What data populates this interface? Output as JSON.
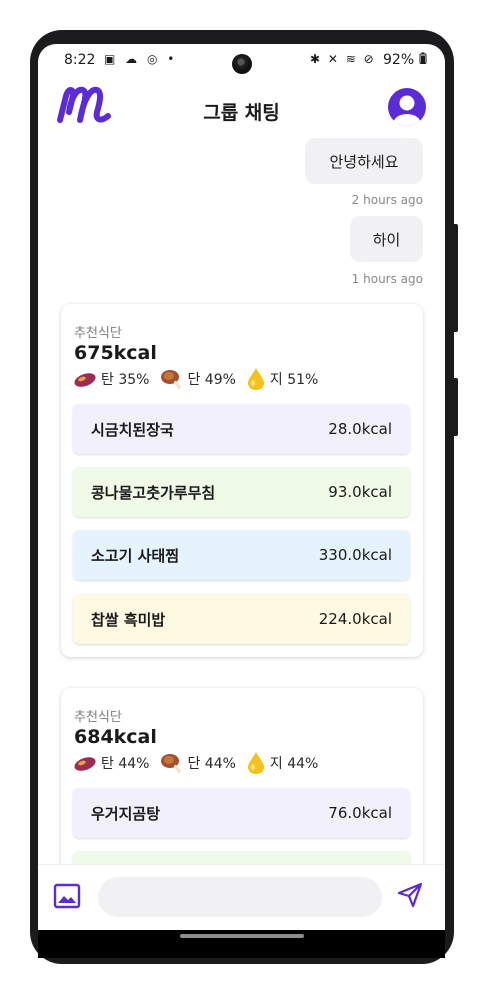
{
  "status_bar": {
    "time": "8:22",
    "left_icons": "▣ ☁ ◎ •",
    "right_icons": "✱ ✕ ≋ ⊘",
    "battery": "92%"
  },
  "header": {
    "title": "그룹 채팅"
  },
  "chat": [
    {
      "text": "안녕하세요",
      "time": "2 hours ago"
    },
    {
      "text": "하이",
      "time": "1 hours ago"
    }
  ],
  "meal_cards": [
    {
      "label": "추천식단",
      "kcal": "675kcal",
      "macros": {
        "carb": "탄 35%",
        "protein": "단 49%",
        "fat": "지 51%"
      },
      "items": [
        {
          "name": "시금치된장국",
          "kcal": "28.0kcal"
        },
        {
          "name": "콩나물고춧가루무침",
          "kcal": "93.0kcal"
        },
        {
          "name": "소고기 사태찜",
          "kcal": "330.0kcal"
        },
        {
          "name": "찹쌀 흑미밥",
          "kcal": "224.0kcal"
        }
      ]
    },
    {
      "label": "추천식단",
      "kcal": "684kcal",
      "macros": {
        "carb": "탄 44%",
        "protein": "단 44%",
        "fat": "지 44%"
      },
      "items": [
        {
          "name": "우거지곰탕",
          "kcal": "76.0kcal"
        },
        {
          "name": "",
          "kcal": ""
        }
      ]
    }
  ],
  "input": {
    "placeholder": ""
  },
  "colors": {
    "brand": "#5b2bd8",
    "bubble": "#f1f1f3"
  }
}
